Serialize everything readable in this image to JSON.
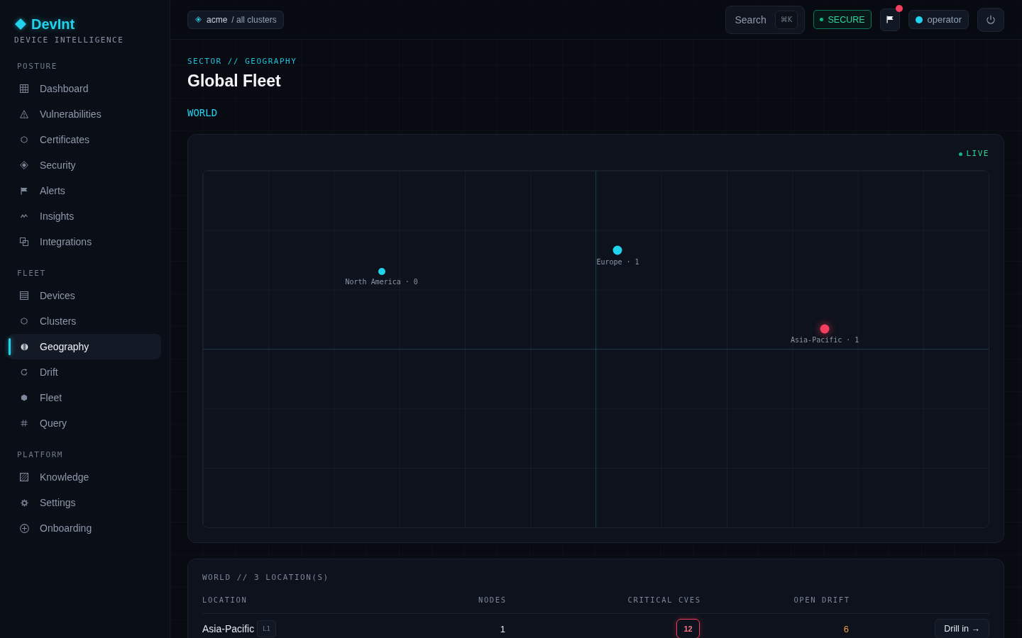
{
  "brand": {
    "name": "DevInt",
    "tagline": "DEVICE INTELLIGENCE"
  },
  "sidebar": {
    "sections": [
      {
        "title": "POSTURE",
        "items": [
          {
            "label": "Dashboard",
            "selected": false
          },
          {
            "label": "Vulnerabilities",
            "selected": false
          },
          {
            "label": "Certificates",
            "selected": false
          },
          {
            "label": "Security",
            "selected": false
          },
          {
            "label": "Alerts",
            "selected": false
          },
          {
            "label": "Insights",
            "selected": false
          },
          {
            "label": "Integrations",
            "selected": false
          }
        ]
      },
      {
        "title": "FLEET",
        "items": [
          {
            "label": "Devices",
            "selected": false
          },
          {
            "label": "Clusters",
            "selected": false
          },
          {
            "label": "Geography",
            "selected": true
          },
          {
            "label": "Drift",
            "selected": false
          },
          {
            "label": "Fleet",
            "selected": false
          },
          {
            "label": "Query",
            "selected": false
          }
        ]
      },
      {
        "title": "PLATFORM",
        "items": [
          {
            "label": "Knowledge",
            "selected": false
          },
          {
            "label": "Settings",
            "selected": false
          },
          {
            "label": "Onboarding",
            "selected": false
          }
        ]
      }
    ]
  },
  "topbar": {
    "breadcrumb": {
      "org": "acme",
      "scope": "/ all clusters"
    },
    "search": {
      "label": "Search",
      "shortcut": "⌘K"
    },
    "status": {
      "label": "SECURE"
    },
    "alerts": {
      "unread": true
    },
    "user": {
      "name": "operator",
      "online": true
    }
  },
  "page": {
    "eyebrow": "SECTOR // GEOGRAPHY",
    "title": "Global Fleet",
    "path": [
      "WORLD"
    ]
  },
  "map": {
    "live": {
      "label": "LIVE",
      "on": true
    },
    "locations": [
      {
        "label": "North America · 0",
        "kind": "idle",
        "color": "#22d3ee"
      },
      {
        "label": "Europe · 1",
        "kind": "active",
        "color": "#22d3ee"
      },
      {
        "label": "Asia-Pacific · 1",
        "kind": "alert",
        "color": "#f43f5e"
      }
    ]
  },
  "table": {
    "caption": "WORLD // 3 LOCATION(S)",
    "columns": [
      "LOCATION",
      "NODES",
      "CRITICAL CVES",
      "OPEN DRIFT"
    ],
    "rows": [
      {
        "location": "Asia-Pacific",
        "tier": "L1",
        "nodes": "1",
        "critical_cves": "12",
        "open_drift": "6",
        "action": "Drill in →"
      }
    ]
  }
}
